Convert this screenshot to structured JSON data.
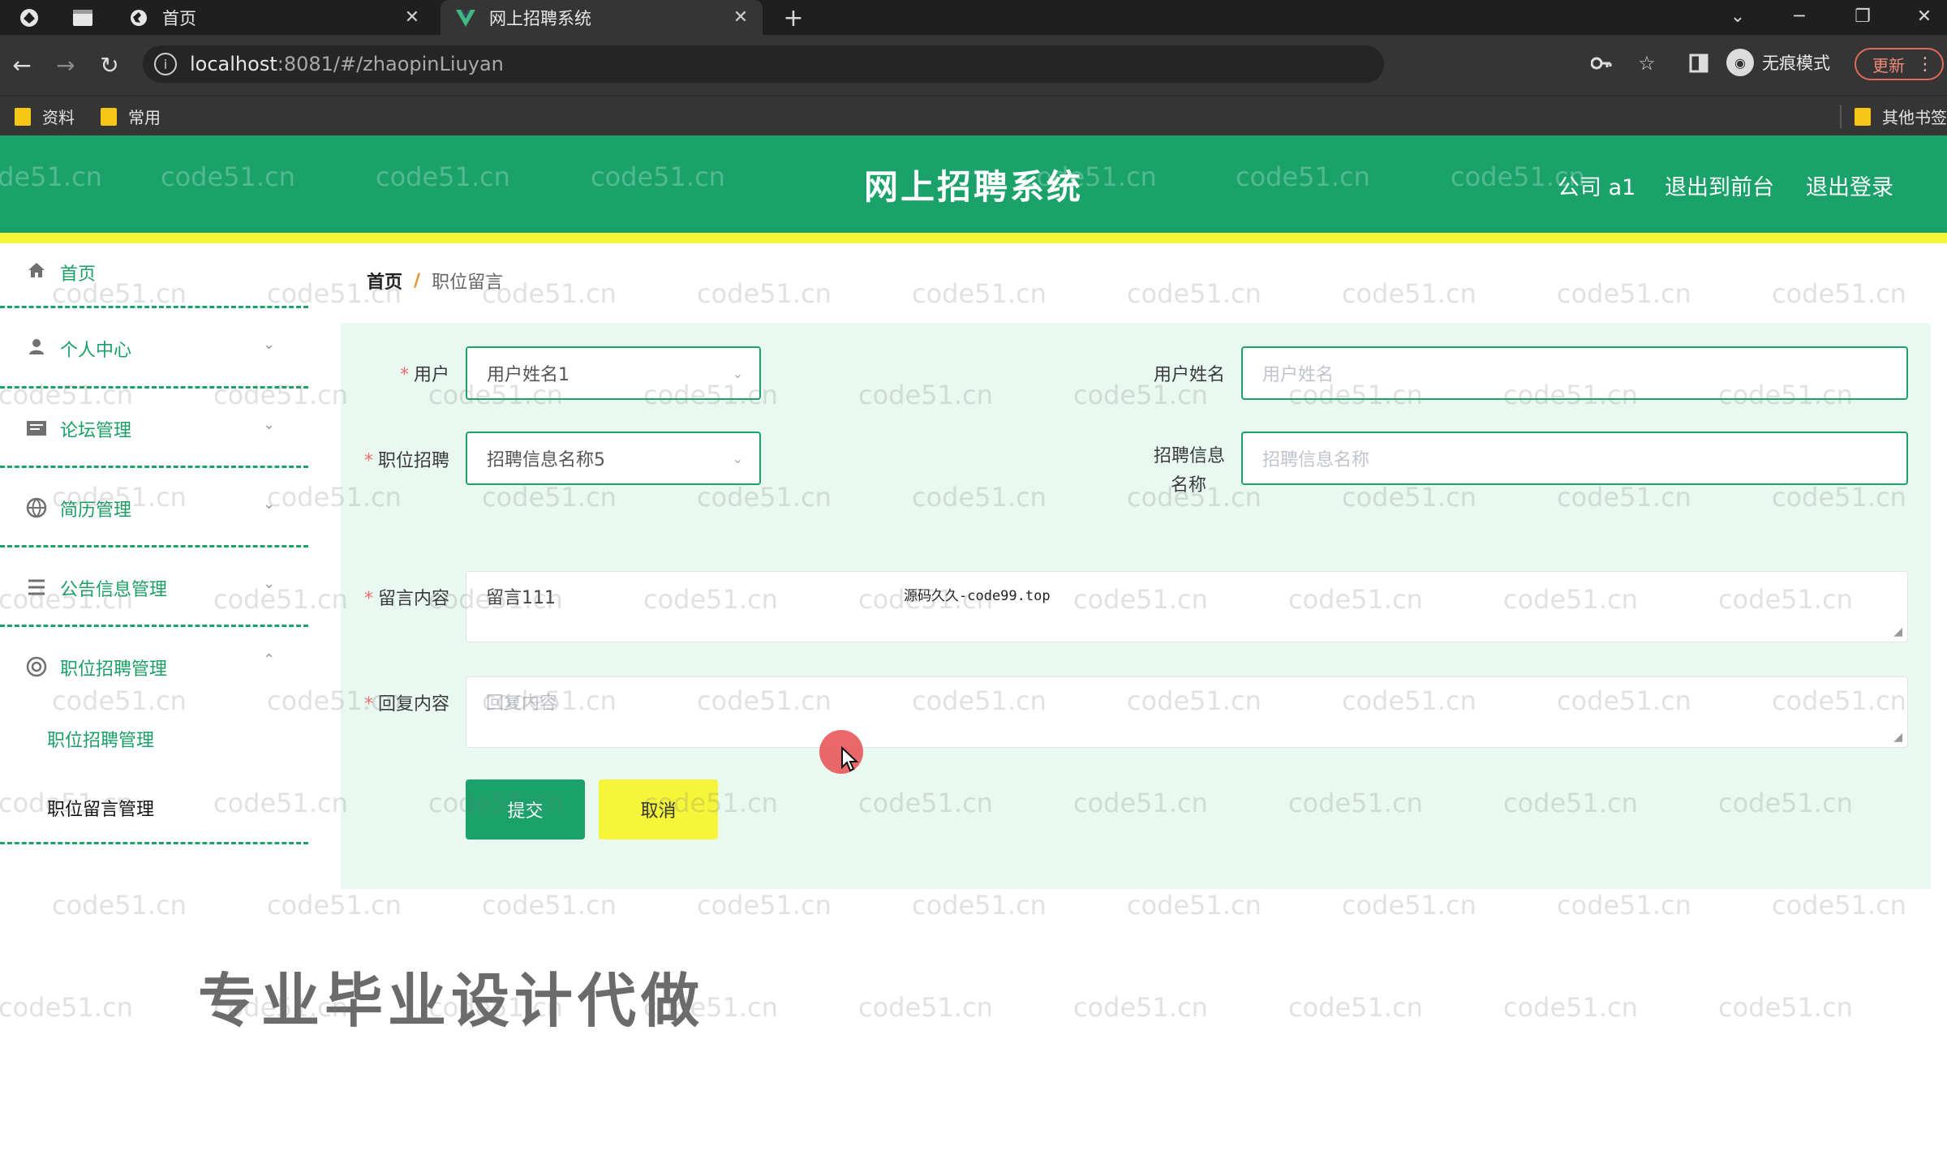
{
  "browser": {
    "tabs": [
      {
        "title": "首页",
        "active": false
      },
      {
        "title": "网上招聘系统",
        "active": true
      }
    ],
    "url_host": "localhost",
    "url_path": ":8081/#/zhaopinLiuyan",
    "incognito_label": "无痕模式",
    "update_label": "更新",
    "bookmarks": [
      "资料",
      "常用"
    ],
    "other_bookmarks": "其他书签"
  },
  "header": {
    "title": "网上招聘系统",
    "user": "公司 a1",
    "to_front": "退出到前台",
    "logout": "退出登录"
  },
  "sidebar": {
    "items": [
      {
        "label": "首页",
        "icon": "home-icon"
      },
      {
        "label": "个人中心",
        "icon": "user-icon"
      },
      {
        "label": "论坛管理",
        "icon": "forum-icon"
      },
      {
        "label": "简历管理",
        "icon": "globe-icon"
      },
      {
        "label": "公告信息管理",
        "icon": "list-icon"
      },
      {
        "label": "职位招聘管理",
        "icon": "target-icon"
      }
    ],
    "sub_items": [
      "职位招聘管理",
      "职位留言管理"
    ]
  },
  "breadcrumb": {
    "home": "首页",
    "separator": "/",
    "current": "职位留言"
  },
  "form": {
    "user_label": "用户",
    "user_value": "用户姓名1",
    "username_label": "用户姓名",
    "username_placeholder": "用户姓名",
    "job_label": "职位招聘",
    "job_value": "招聘信息名称5",
    "jobinfo_label_line1": "招聘信息",
    "jobinfo_label_line2": "名称",
    "jobinfo_placeholder": "招聘信息名称",
    "message_label": "留言内容",
    "message_value": "留言111",
    "reply_label": "回复内容",
    "reply_placeholder": "回复内容",
    "submit": "提交",
    "cancel": "取消"
  },
  "overlay_note": "源码久久-code99.top",
  "promo_text": "专业毕业设计代做",
  "watermark_text": "code51.cn",
  "colors": {
    "brand_green": "#1aa26a",
    "accent_yellow": "#f5f53a",
    "panel_bg": "#e9f8f1"
  }
}
